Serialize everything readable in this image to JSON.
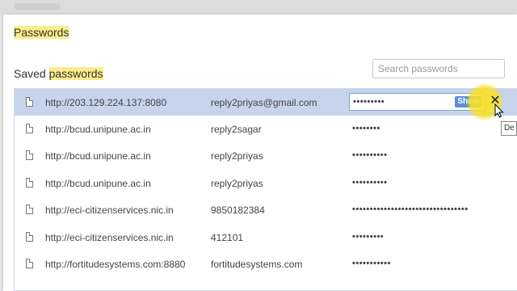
{
  "header": {
    "title": "Passwords"
  },
  "saved": {
    "prefix": "Saved ",
    "highlight": "passwords"
  },
  "search": {
    "placeholder": "Search passwords"
  },
  "rows": [
    {
      "site": "http://203.129.224.137:8080",
      "user": "reply2priyas@gmail.com",
      "password": "•••••••••",
      "selected": true,
      "show_label": "Show"
    },
    {
      "site": "http://bcud.unipune.ac.in",
      "user": "reply2sagar",
      "password": "••••••••"
    },
    {
      "site": "http://bcud.unipune.ac.in",
      "user": "reply2priyas",
      "password": "••••••••••"
    },
    {
      "site": "http://bcud.unipune.ac.in",
      "user": "reply2priyas",
      "password": "••••••••••"
    },
    {
      "site": "http://eci-citizenservices.nic.in",
      "user": "9850182384",
      "password": "•••••••••••••••••••••••••••••••••"
    },
    {
      "site": "http://eci-citizenservices.nic.in",
      "user": "412101",
      "password": "•••••••••"
    },
    {
      "site": "http://fortitudesystems.com:8880",
      "user": "fortitudesystems.com",
      "password": "•••••••••••"
    }
  ],
  "tooltip": {
    "text": "De"
  },
  "colors": {
    "highlight": "#fbec8c",
    "selected_row": "#c6d4ec",
    "show_button": "#5b8fd6"
  }
}
